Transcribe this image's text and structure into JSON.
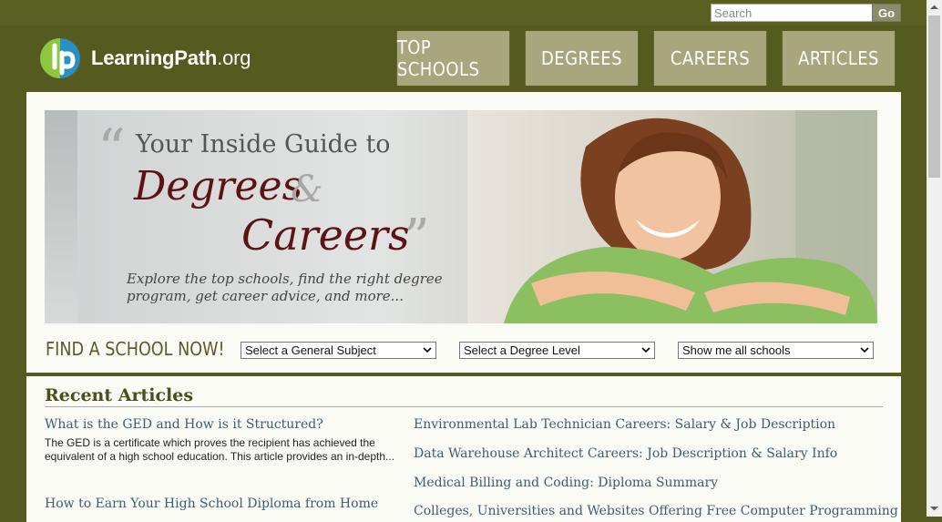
{
  "search": {
    "placeholder": "Search",
    "button_label": "Go"
  },
  "logo": {
    "name": "LearningPath",
    "tld": ".org"
  },
  "nav": {
    "items": [
      "TOP SCHOOLS",
      "DEGREES",
      "CAREERS",
      "ARTICLES"
    ]
  },
  "hero": {
    "line1": "Your Inside Guide to",
    "degrees": "Degrees",
    "amp": "&",
    "careers": "Careers",
    "subtitle": "Explore the top schools, find the right degree program, get career advice, and more..."
  },
  "finder": {
    "label": "FIND A SCHOOL NOW!",
    "subject": "Select a General Subject",
    "degree": "Select a Degree Level",
    "schools": "Show me all schools"
  },
  "articles": {
    "title": "Recent Articles",
    "left": [
      {
        "title": "What is the GED and How is it Structured?",
        "excerpt": "The GED is a certificate which proves the recipient has achieved the equivalent of a high school education. This article provides an in-depth..."
      },
      {
        "title": "How to Earn Your High School Diploma from Home"
      }
    ],
    "right": [
      "Environmental Lab Technician Careers: Salary & Job Description",
      "Data Warehouse Architect Careers: Job Description & Salary Info",
      "Medical Billing and Coding: Diploma Summary",
      "Colleges, Universities and Websites Offering Free Computer Programming"
    ]
  },
  "colors": {
    "header_bg": "#555b1f",
    "nav_bg": "#a7a67d",
    "heading": "#5e1215",
    "link": "#3d5d70"
  }
}
